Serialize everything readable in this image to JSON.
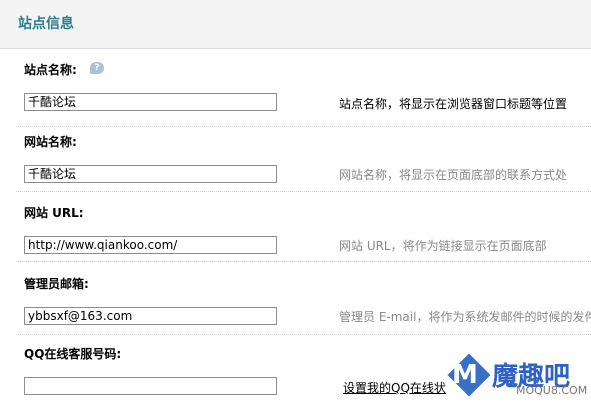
{
  "header": {
    "title": "站点信息"
  },
  "fields": [
    {
      "label": "站点名称:",
      "value": "千酷论坛",
      "description": "站点名称，将显示在浏览器窗口标题等位置",
      "has_help": true
    },
    {
      "label": "网站名称:",
      "value": "千酷论坛",
      "description": "网站名称，将显示在页面底部的联系方式处"
    },
    {
      "label": "网站 URL:",
      "value": "http://www.qiankoo.com/",
      "description": "网站 URL，将作为链接显示在页面底部"
    },
    {
      "label": "管理员邮箱:",
      "value": "ybbsxf@163.com",
      "description": "管理员 E-mail，将作为系统发邮件的时候的发件"
    },
    {
      "label": "QQ在线客服号码:",
      "value": "",
      "description": "设置我的QQ在线状"
    }
  ],
  "help_icon": {
    "name": "help-bubble-icon",
    "glyph": "?"
  },
  "watermark": {
    "logo_text": "魔趣吧",
    "url": "MOQU8.COM",
    "icon": "m-cube-logo"
  }
}
